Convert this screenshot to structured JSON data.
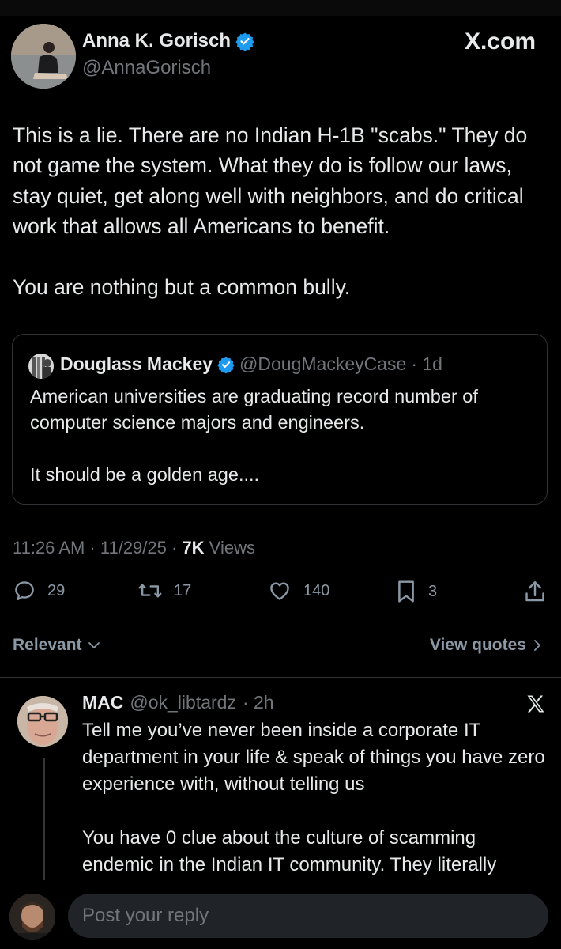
{
  "tweet": {
    "author_name": "Anna K. Gorisch",
    "author_handle": "@AnnaGorisch",
    "site_label": "X.com",
    "paragraphs": [
      "This is a lie. There are no Indian H-1B \"scabs.\" They do not game the system. What they do is follow our laws, stay quiet, get along well with neighbors, and do critical work that allows all Americans to benefit.",
      "You are nothing but a common bully."
    ],
    "quote": {
      "author_name": "Douglass Mackey",
      "author_handle": "@DougMackeyCase",
      "age": "· 1d",
      "paragraphs": [
        "American universities are graduating record number of computer science majors and engineers.",
        "It should be a golden age...."
      ]
    },
    "meta": {
      "time": "11:26 AM · 11/29/25 · ",
      "views_count": "7K",
      "views_label": " Views"
    },
    "actions": {
      "replies": "29",
      "reposts": "17",
      "likes": "140",
      "bookmarks": "3"
    }
  },
  "filters": {
    "sort_label": "Relevant",
    "view_quotes_label": "View quotes"
  },
  "reply": {
    "author_name": "MAC",
    "author_handle": "@ok_libtardz",
    "age": "· 2h",
    "paragraphs": [
      "Tell me you’ve never been inside a corporate IT department in your life & speak of things you have zero experience with, without telling us",
      "You have 0 clue about the culture of scamming endemic in the Indian IT community. They literally"
    ]
  },
  "composer": {
    "placeholder": "Post your reply"
  },
  "colors": {
    "background": "#000000",
    "text": "#e7e9ea",
    "muted": "#71767b",
    "verified": "#1d9bf0",
    "border": "#2f3336"
  }
}
